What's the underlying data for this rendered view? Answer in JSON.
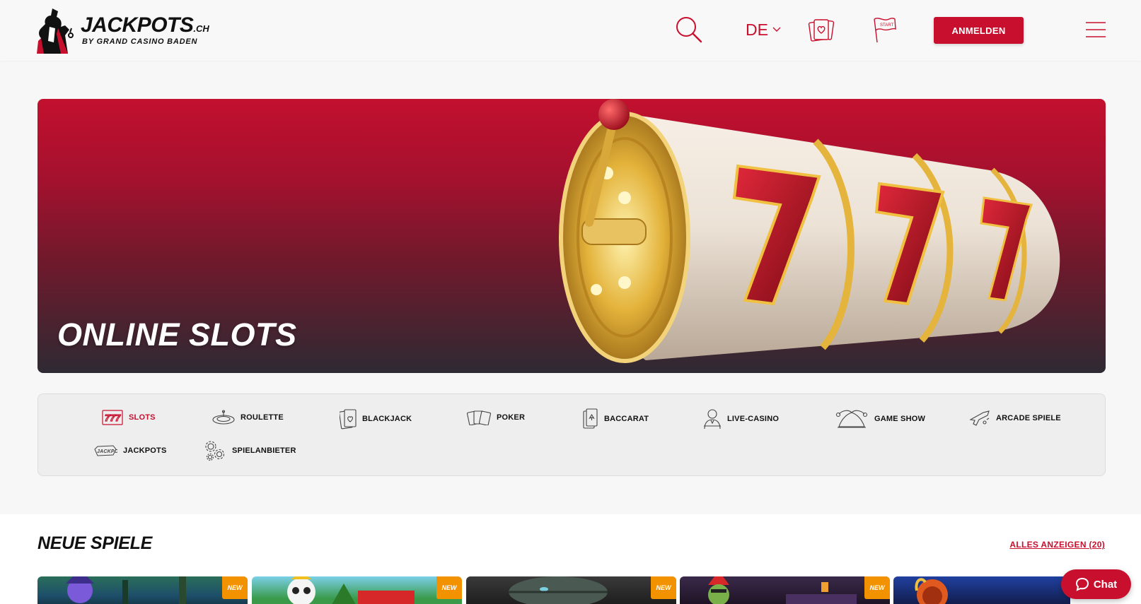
{
  "header": {
    "logo_word": "JACKPOTS",
    "logo_tld": ".CH",
    "logo_sub": "BY GRAND CASINO BADEN",
    "language": "DE",
    "login_label": "ANMELDEN"
  },
  "hero": {
    "title": "ONLINE SLOTS"
  },
  "categories": [
    {
      "label": "SLOTS",
      "icon": "slot-777-icon",
      "active": true
    },
    {
      "label": "ROULETTE",
      "icon": "roulette-icon",
      "active": false
    },
    {
      "label": "BLACKJACK",
      "icon": "blackjack-cards-icon",
      "active": false
    },
    {
      "label": "POKER",
      "icon": "poker-cards-icon",
      "active": false
    },
    {
      "label": "BACCARAT",
      "icon": "baccarat-card-icon",
      "active": false
    },
    {
      "label": "LIVE-CASINO",
      "icon": "live-dealer-icon",
      "active": false
    },
    {
      "label": "GAME SHOW",
      "icon": "jester-hat-icon",
      "active": false
    },
    {
      "label": "ARCADE SPIELE",
      "icon": "arcade-gun-icon",
      "active": false
    },
    {
      "label": "JACKPOTS",
      "icon": "jackpot-badge-icon",
      "active": false
    },
    {
      "label": "SPIELANBIETER",
      "icon": "gears-icon",
      "active": false
    }
  ],
  "new_games": {
    "title": "NEUE SPIELE",
    "show_all": "ALLES ANZEIGEN (20)",
    "badge": "NEW"
  },
  "chat": {
    "label": "Chat"
  },
  "colors": {
    "brand_red": "#c8102e",
    "badge_orange": "#f39200"
  }
}
